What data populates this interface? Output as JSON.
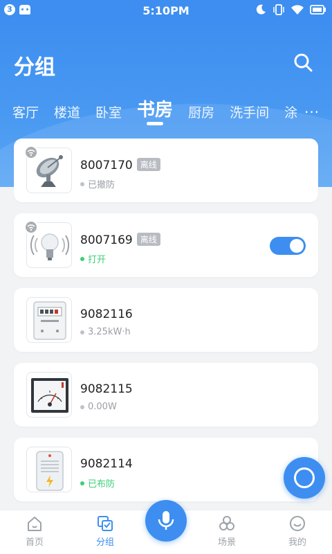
{
  "status_bar": {
    "notification_count": "3",
    "time": "5:10PM"
  },
  "header": {
    "title": "分组",
    "tabs": [
      {
        "label": "客厅",
        "active": false
      },
      {
        "label": "楼道",
        "active": false
      },
      {
        "label": "卧室",
        "active": false
      },
      {
        "label": "书房",
        "active": true
      },
      {
        "label": "厨房",
        "active": false
      },
      {
        "label": "洗手间",
        "active": false
      },
      {
        "label": "涂",
        "active": false
      }
    ],
    "more": "···"
  },
  "devices": [
    {
      "id": "8007170",
      "tag": "离线",
      "status": "已撤防",
      "status_color": "gray",
      "icon": "satellite-dish-icon",
      "online_badge": true,
      "has_toggle": false
    },
    {
      "id": "8007169",
      "tag": "离线",
      "status": "打开",
      "status_color": "green",
      "icon": "light-bulb-icon",
      "online_badge": true,
      "has_toggle": true,
      "toggle_on": true
    },
    {
      "id": "9082116",
      "tag": "",
      "status": "3.25kW·h",
      "status_color": "gray",
      "icon": "electricity-meter-icon",
      "online_badge": false,
      "has_toggle": false
    },
    {
      "id": "9082115",
      "tag": "",
      "status": "0.00W",
      "status_color": "gray",
      "icon": "power-gauge-icon",
      "online_badge": false,
      "has_toggle": false
    },
    {
      "id": "9082114",
      "tag": "",
      "status": "已布防",
      "status_color": "green",
      "icon": "alarm-siren-icon",
      "online_badge": false,
      "has_toggle": false
    }
  ],
  "bottom_nav": [
    {
      "label": "首页",
      "icon": "home-icon",
      "active": false
    },
    {
      "label": "分组",
      "icon": "group-icon",
      "active": true
    },
    {
      "label": "场景",
      "icon": "scene-icon",
      "active": false
    },
    {
      "label": "我的",
      "icon": "profile-icon",
      "active": false
    }
  ],
  "colors": {
    "primary": "#3d8ef0",
    "status_green": "#3ccf73",
    "tag_gray": "#b8bcc2"
  }
}
